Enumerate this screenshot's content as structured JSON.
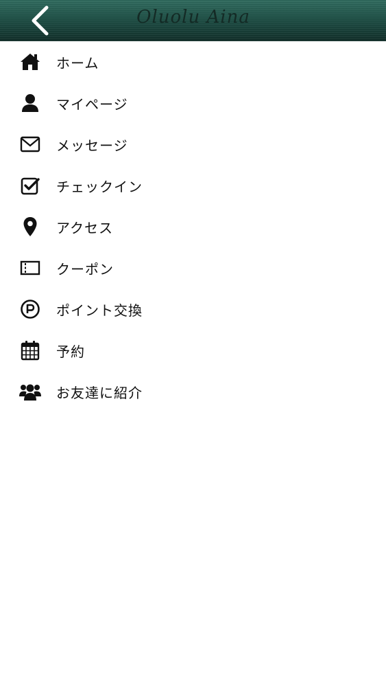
{
  "header": {
    "logo_text": "Oluolu Aina"
  },
  "icons": {
    "back": "chevron-left-icon",
    "home": "home-icon",
    "mypage": "user-icon",
    "message": "envelope-icon",
    "checkin": "check-square-icon",
    "access": "map-pin-icon",
    "coupon": "ticket-icon",
    "points": "parking-circle-icon",
    "reservation": "calendar-icon",
    "referral": "users-icon"
  },
  "menu": {
    "items": [
      {
        "label": "ホーム"
      },
      {
        "label": "マイページ"
      },
      {
        "label": "メッセージ"
      },
      {
        "label": "チェックイン"
      },
      {
        "label": "アクセス"
      },
      {
        "label": "クーポン"
      },
      {
        "label": "ポイント交換"
      },
      {
        "label": "予約"
      },
      {
        "label": "お友達に紹介"
      }
    ]
  },
  "colors": {
    "header_top": "#2f6b5e",
    "header_bottom": "#0f2c27",
    "text": "#111111",
    "icon": "#111111",
    "background": "#ffffff"
  }
}
